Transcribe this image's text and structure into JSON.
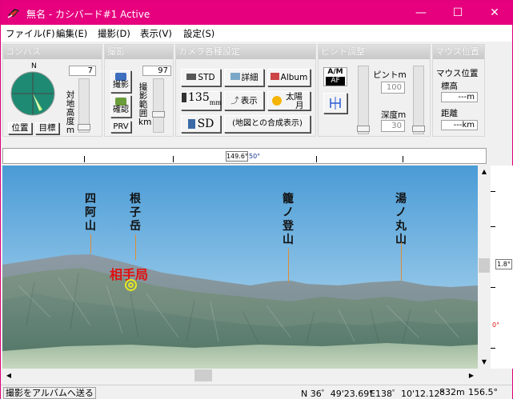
{
  "title": {
    "text": "無名 - カシバード#1 Active",
    "minimize": "—",
    "maximize": "☐",
    "close": "✕"
  },
  "menu": {
    "items": [
      "ファイル(F)",
      "編集(E)",
      "撮影(D)",
      "表示(V)",
      "設定(S)"
    ]
  },
  "compass": {
    "title": "コンパス",
    "north": "N",
    "altitude_value": "7",
    "altitude_label": "対地高度m",
    "position_button": "位置",
    "target_button": "目標"
  },
  "shoot": {
    "title": "撮影",
    "shoot_button": "撮影",
    "confirm_button": "確認",
    "prv_button": "PRV",
    "range_value": "97",
    "range_label": "撮影範囲km"
  },
  "camera": {
    "title": "カメラ各種設定",
    "std_button": "STD",
    "detail_button": "詳細",
    "album_button": "Album",
    "lens_button": "135",
    "lens_unit": "mm",
    "display_button": "表示",
    "sun_button": "太陽",
    "moon_label": "月",
    "sd_button": "SD",
    "composite_button": "(地図との合成表示)"
  },
  "focus": {
    "title": "ピント調整",
    "am_label": "A/M",
    "af_label": "AF",
    "focus_label": "ピントm",
    "focus_value": "100",
    "depth_label": "深度m",
    "depth_value": "30"
  },
  "mouse": {
    "title": "マウス位置",
    "elevation_label": "標高",
    "elevation_value": "---m",
    "distance_label": "距離",
    "distance_value": "---km"
  },
  "ruler": {
    "angle_box": "149.6°",
    "angle_text": "50°"
  },
  "view": {
    "peaks": [
      "四阿山",
      "根子岳",
      "籠ノ登山",
      "湯ノ丸山"
    ],
    "site_label": "相手局",
    "right_angle": "1.8°",
    "zero_label": "0°",
    "sky_top": "#4a9bd6",
    "sky_bottom": "#bcdff2"
  },
  "status": {
    "message": "撮影をアルバムへ送る",
    "lat": "N 36゜49'23.69\"",
    "lon": "E138゜10'12.12\"",
    "elev": "832m",
    "angle": "156.5°"
  }
}
